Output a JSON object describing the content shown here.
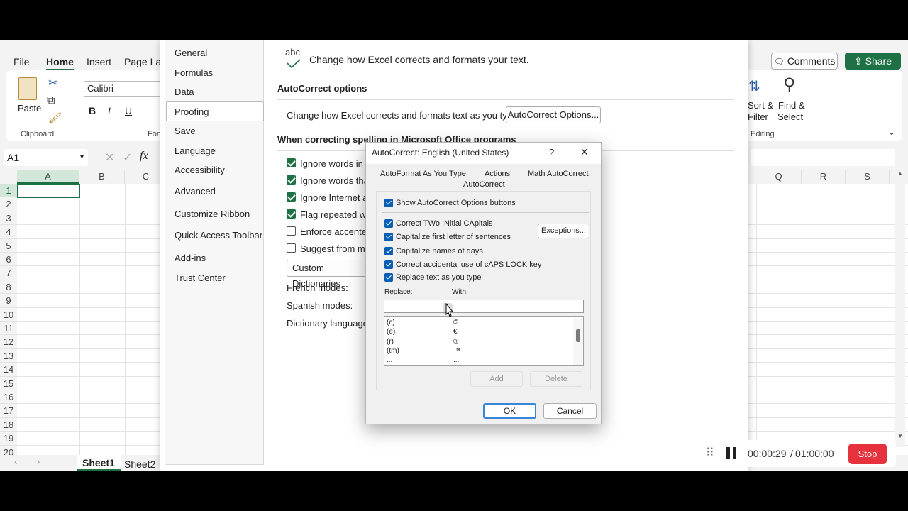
{
  "excel": {
    "menu_tabs": [
      "File",
      "Home",
      "Insert",
      "Page Lay"
    ],
    "comments_label": "Comments",
    "share_label": "Share",
    "clipboard": {
      "paste": "Paste",
      "group": "Clipboard"
    },
    "font_name": "Calibri",
    "font_group": "Fon",
    "editing": {
      "sort_line1": "Sort &",
      "sort_line2": "Filter",
      "find_line1": "Find &",
      "find_line2": "Select",
      "group": "Editing"
    },
    "name_box": "A1",
    "fx": "fx",
    "columns_left": [
      "A",
      "B",
      "C"
    ],
    "columns_right": [
      "Q",
      "R",
      "S"
    ],
    "rows": [
      "1",
      "2",
      "3",
      "4",
      "5",
      "6",
      "7",
      "8",
      "9",
      "10",
      "11",
      "12",
      "13",
      "14",
      "15",
      "16",
      "17",
      "18",
      "19",
      "20"
    ],
    "sheets": [
      "Sheet1",
      "Sheet2"
    ]
  },
  "options": {
    "nav": [
      "General",
      "Formulas",
      "Data",
      "Proofing",
      "Save",
      "Language",
      "Accessibility",
      "Advanced",
      "Customize Ribbon",
      "Quick Access Toolbar",
      "Add-ins",
      "Trust Center"
    ],
    "abc_label": "abc",
    "header_text": "Change how Excel corrects and formats your text.",
    "autocorrect_heading": "AutoCorrect options",
    "autocorrect_desc": "Change how Excel corrects and formats text as you type:",
    "autocorrect_button": "AutoCorrect Options...",
    "spelling_heading": "When correcting spelling in Microsoft Office programs",
    "spelling_options": [
      "Ignore words in U",
      "Ignore words tha",
      "Ignore Internet an",
      "Flag repeated wo",
      "Enforce accented",
      "Suggest from ma"
    ],
    "custom_dict_button": "Custom Dictionaries",
    "french_label": "French modes:",
    "spanish_label": "Spanish modes:",
    "dictionary_label": "Dictionary language:"
  },
  "dialog": {
    "title": "AutoCorrect: English (United States)",
    "help": "?",
    "close": "✕",
    "tabs": [
      "AutoFormat As You Type",
      "Actions",
      "Math AutoCorrect",
      "AutoCorrect"
    ],
    "show_buttons": "Show AutoCorrect Options buttons",
    "checks": [
      "Correct TWo INitial CApitals",
      "Capitalize first letter of sentences",
      "Capitalize names of days",
      "Correct accidental use of cAPS LOCK key",
      "Replace text as you type"
    ],
    "exceptions_button": "Exceptions...",
    "replace_label": "Replace:",
    "with_label": "With:",
    "replace_value": "",
    "list": [
      [
        "(c)",
        "©"
      ],
      [
        "(e)",
        "€"
      ],
      [
        "(r)",
        "®"
      ],
      [
        "(tm)",
        "™"
      ],
      [
        "...",
        "..."
      ]
    ],
    "add_button": "Add",
    "delete_button": "Delete",
    "ok_button": "OK",
    "cancel_button": "Cancel"
  },
  "recorder": {
    "elapsed": "00:00:29",
    "separator": "/",
    "total": "01:00:00",
    "stop": "Stop"
  }
}
